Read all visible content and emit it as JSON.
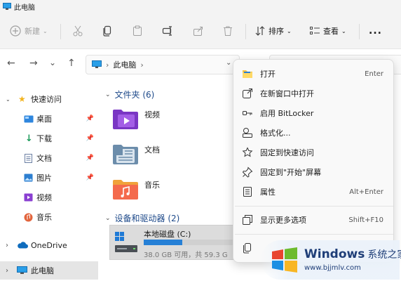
{
  "window": {
    "title": "此电脑"
  },
  "toolbar": {
    "new_label": "新建",
    "sort_label": "排序",
    "view_label": "查看",
    "more_label": "..."
  },
  "address": {
    "path": "此电脑"
  },
  "sidebar": {
    "items": [
      {
        "label": "快速访问"
      },
      {
        "label": "桌面"
      },
      {
        "label": "下载"
      },
      {
        "label": "文档"
      },
      {
        "label": "图片"
      },
      {
        "label": "视频"
      },
      {
        "label": "音乐"
      },
      {
        "label": "OneDrive"
      },
      {
        "label": "此电脑"
      }
    ]
  },
  "main": {
    "folders_group": "文件夹 (6)",
    "folders": [
      {
        "label": "视频"
      },
      {
        "label": "文档"
      },
      {
        "label": "音乐"
      }
    ],
    "drives_group": "设备和驱动器 (2)",
    "drive": {
      "name": "本地磁盘 (C:)",
      "used_fraction": 0.36,
      "size_text": "38.0 GB 可用，共 59.3 G"
    }
  },
  "context_menu": {
    "items": [
      {
        "label": "打开",
        "shortcut": "Enter"
      },
      {
        "label": "在新窗口中打开",
        "shortcut": ""
      },
      {
        "label": "启用 BitLocker",
        "shortcut": ""
      },
      {
        "label": "格式化...",
        "shortcut": ""
      },
      {
        "label": "固定到快速访问",
        "shortcut": ""
      },
      {
        "label": "固定到\"开始\"屏幕",
        "shortcut": ""
      },
      {
        "label": "属性",
        "shortcut": "Alt+Enter"
      },
      {
        "label": "显示更多选项",
        "shortcut": "Shift+F10"
      }
    ]
  },
  "watermark": {
    "brand": "Windows",
    "suffix": "系统之家",
    "url": "www.bjjmlv.com"
  },
  "colors": {
    "accent": "#0067c0",
    "drive_fill": "#2680d6",
    "folder_yellow": "#f5c344"
  }
}
